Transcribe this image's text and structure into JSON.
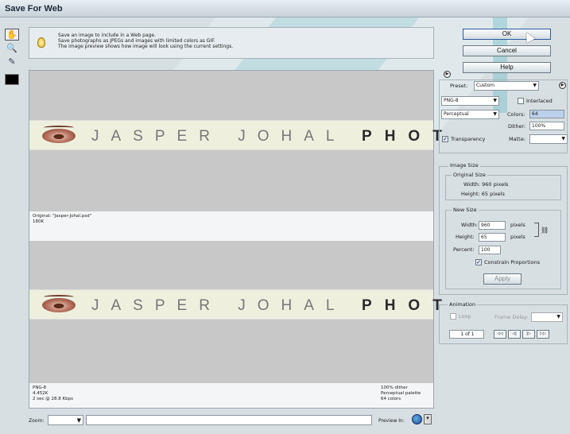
{
  "window": {
    "title": "Save For Web"
  },
  "tools": [
    "hand-icon",
    "zoom-icon",
    "eyedropper-icon"
  ],
  "info": {
    "lines": [
      "Save an image to include in a Web page.",
      "Save photographs as JPEGs and images with limited colors as GIF.",
      "The image preview shows how image will look using the current settings."
    ]
  },
  "preview": {
    "banner_text": "JASPER JOHAL",
    "banner_bold": "PHOT",
    "original_caption": [
      "Original: \"Jasper-Johal.psd\"",
      "180K"
    ],
    "optimized_left": [
      "PNG-8",
      "4.452K",
      "2 sec @ 28.8 Kbps"
    ],
    "optimized_right": [
      "100% dither",
      "Perceptual palette",
      "64 colors"
    ]
  },
  "bottom": {
    "zoom_label": "Zoom:",
    "zoom_value": "",
    "preview_label": "Preview In:"
  },
  "buttons": {
    "ok": "OK",
    "cancel": "Cancel",
    "help": "Help",
    "apply": "Apply"
  },
  "settings": {
    "preset_label": "Preset:",
    "preset_value": "Custom",
    "format_value": "PNG-8",
    "interlaced_label": "Interlaced",
    "palette_value": "Perceptual",
    "colors_label": "Colors:",
    "colors_value": "64",
    "dither_label": "Dither:",
    "dither_value": "100%",
    "transparency_label": "Transparency",
    "matte_label": "Matte:"
  },
  "image_size": {
    "title": "Image Size",
    "original_title": "Original Size",
    "width_text": "Width: 960 pixels",
    "height_text": "Height: 65 pixels",
    "new_title": "New Size",
    "width_label": "Width:",
    "width_value": "960",
    "height_label": "Height:",
    "height_value": "65",
    "pixels_label": "pixels",
    "percent_label": "Percent:",
    "percent_value": "100",
    "constrain_label": "Constrain Proportions"
  },
  "animation": {
    "title": "Animation",
    "loop_label": "Loop",
    "delay_label": "Frame Delay:",
    "frame_counter": "1 of 1",
    "nav": [
      "first-frame",
      "prev-frame",
      "next-frame",
      "last-frame"
    ]
  }
}
